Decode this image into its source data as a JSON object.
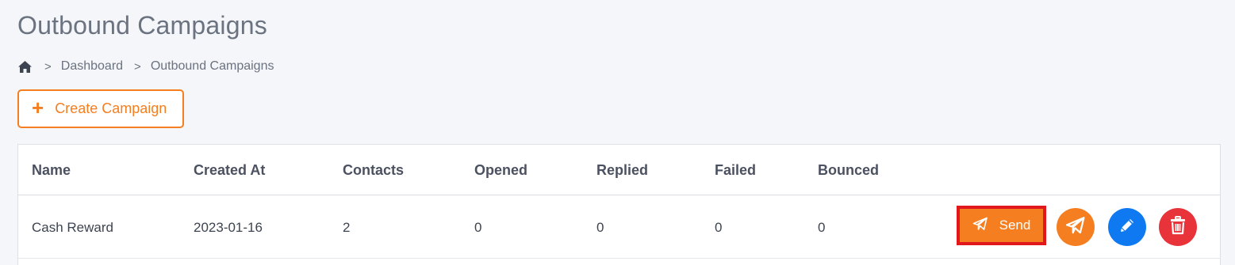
{
  "page": {
    "title": "Outbound Campaigns"
  },
  "breadcrumb": {
    "home_icon": "home-icon",
    "items": [
      "Dashboard",
      "Outbound Campaigns"
    ],
    "separator": ">"
  },
  "toolbar": {
    "create_icon": "+",
    "create_label": "Create Campaign"
  },
  "table": {
    "columns": [
      "Name",
      "Created At",
      "Contacts",
      "Opened",
      "Replied",
      "Failed",
      "Bounced"
    ],
    "rows": [
      {
        "name": "Cash Reward",
        "created_at": "2023-01-16",
        "contacts": "2",
        "opened": "0",
        "replied": "0",
        "failed": "0",
        "bounced": "0",
        "actions": {
          "send_label": "Send",
          "send_icon": "paper-plane-icon",
          "secondary_send_icon": "paper-plane-icon",
          "edit_icon": "pencil-icon",
          "delete_icon": "trash-icon"
        }
      }
    ]
  },
  "colors": {
    "accent": "#f47e20",
    "edit": "#0f79f2",
    "delete": "#e8333a",
    "highlight": "#e0181e"
  }
}
